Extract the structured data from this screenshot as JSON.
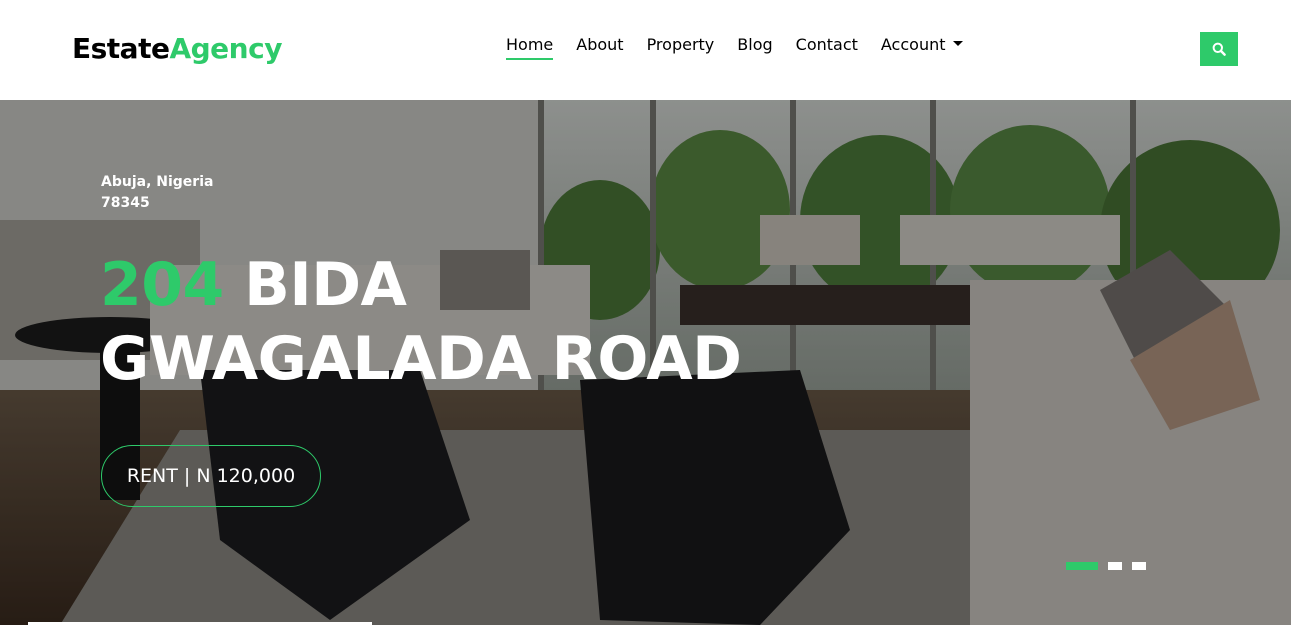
{
  "logo": {
    "part1": "Estate",
    "part2": "Agency"
  },
  "nav": {
    "items": [
      {
        "label": "Home",
        "active": true
      },
      {
        "label": "About"
      },
      {
        "label": "Property"
      },
      {
        "label": "Blog"
      },
      {
        "label": "Contact"
      },
      {
        "label": "Account",
        "dropdown": true
      }
    ],
    "search_icon": "search-icon"
  },
  "hero": {
    "address_line1": "Abuja, Nigeria",
    "address_line2": "78345",
    "title_number": "204",
    "title_rest1": " BIDA",
    "title_rest2": "GWAGALADA ROAD",
    "price_label": "RENT | N 120,000",
    "slides": {
      "count": 3,
      "active_index": 0
    }
  },
  "colors": {
    "accent": "#2eca6a",
    "text": "#000000",
    "hero_text": "#ffffff"
  }
}
